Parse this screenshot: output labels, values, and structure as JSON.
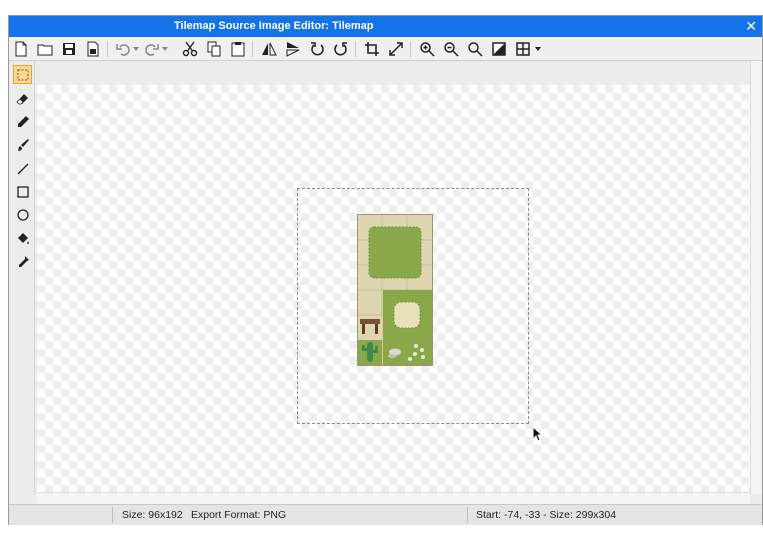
{
  "window": {
    "title": "Tilemap Source Image Editor: Tilemap",
    "close_glyph": "✕"
  },
  "toolbar": {
    "items": [
      "new-file-icon",
      "open-folder-icon",
      "save-icon",
      "save-as-icon",
      "undo-icon",
      "redo-icon",
      "cut-icon",
      "copy-icon",
      "paste-icon",
      "flip-horizontal-icon",
      "flip-vertical-icon",
      "rotate-left-icon",
      "rotate-right-icon",
      "crop-icon",
      "resize-icon",
      "zoom-in-icon",
      "zoom-out-icon",
      "zoom-fit-icon",
      "zoom-actual-icon",
      "grid-icon"
    ]
  },
  "tools": [
    "select-rect-icon",
    "eraser-icon",
    "pencil-icon",
    "brush-icon",
    "line-icon",
    "rectangle-icon",
    "ellipse-icon",
    "fill-bucket-icon",
    "eyedropper-icon"
  ],
  "status": {
    "size": "Size: 96x192",
    "export_format": "Export Format: PNG",
    "selection": "Start: -74, -33 - Size: 299x304"
  },
  "colors": {
    "titlebar": "#1473e6",
    "sand": "#ded6b0",
    "grass": "#8aa84a",
    "grass_dark": "#6f9238",
    "table": "#7a5232",
    "cactus": "#3f8a4a",
    "active_tool": "#ffd88a"
  }
}
